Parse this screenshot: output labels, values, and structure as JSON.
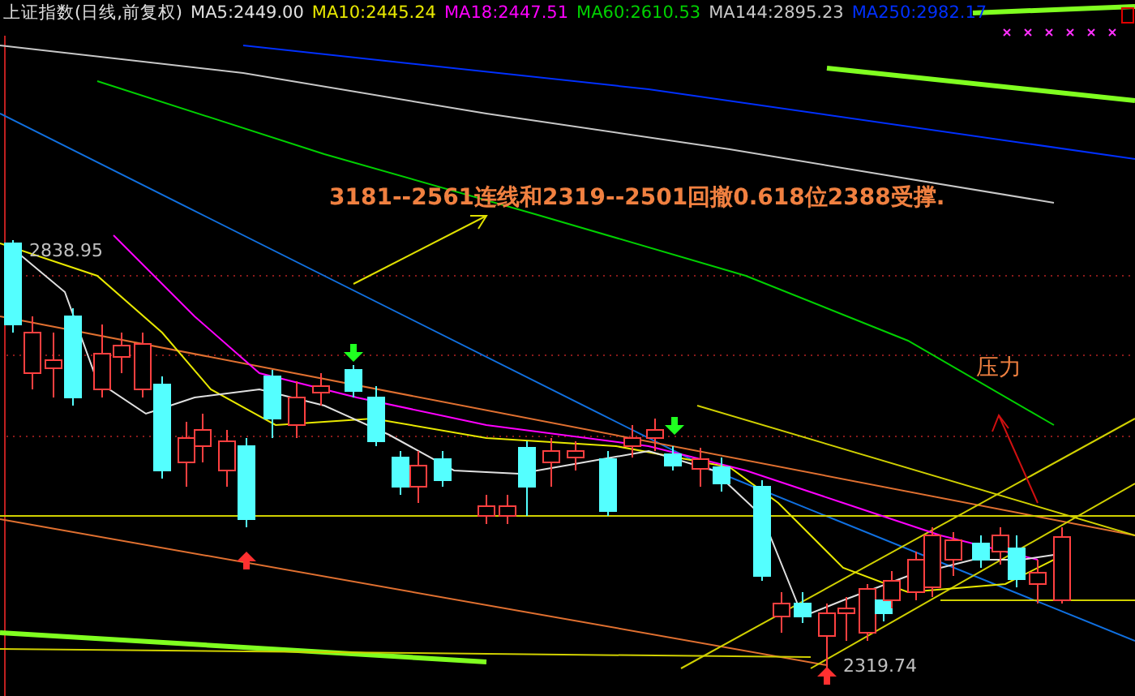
{
  "header": {
    "title": "上证指数(日线,前复权)",
    "indicators": [
      {
        "label": "MA5:2449.00",
        "color": "#e0e0e0"
      },
      {
        "label": "MA10:2445.24",
        "color": "#e8e800"
      },
      {
        "label": "MA18:2447.51",
        "color": "#ff00ff"
      },
      {
        "label": "MA60:2610.53",
        "color": "#00d000"
      },
      {
        "label": "MA144:2895.23",
        "color": "#c8c8c8"
      },
      {
        "label": "MA250:2982.17",
        "color": "#0030ff"
      }
    ]
  },
  "annotations": [
    {
      "kind": "note",
      "text": "3181--2561连线和2319--2501回撤0.618位2388受撑."
    },
    {
      "kind": "price",
      "text": "2838.95"
    },
    {
      "kind": "label",
      "text": "压力"
    },
    {
      "kind": "price",
      "text": "2319.74"
    }
  ]
}
